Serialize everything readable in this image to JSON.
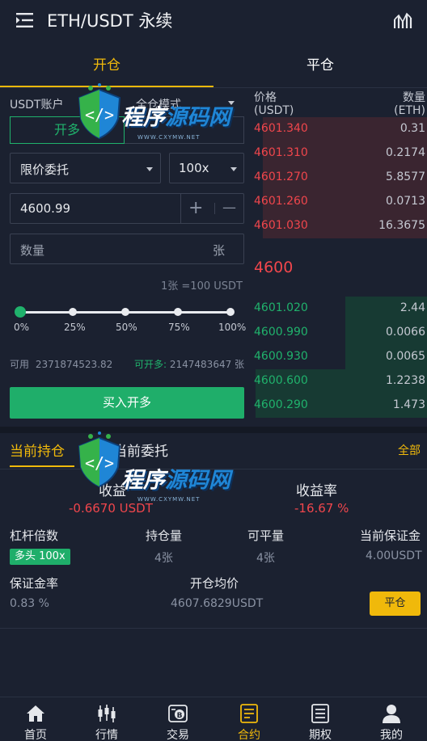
{
  "header": {
    "title": "ETH/USDT 永续"
  },
  "tabs": {
    "open": "开仓",
    "close": "平仓"
  },
  "form": {
    "account": "USDT账户",
    "margin_mode": "全仓模式",
    "side_long": "开多",
    "order_type": "限价委托",
    "leverage": "100x",
    "price": "4600.99",
    "plus": "+",
    "minus": "—",
    "qty_placeholder": "数量",
    "qty_unit": "张",
    "contract_note": "1张 =100 USDT",
    "slider": {
      "value_pct": 0,
      "labels": [
        "0%",
        "25%",
        "50%",
        "75%",
        "100%"
      ]
    },
    "available_label": "可用",
    "available_value": "2371874523.82",
    "can_open_label": "可开多:",
    "can_open_value": "2147483647 张",
    "buy_button": "买入开多"
  },
  "orderbook": {
    "price_header": "价格",
    "price_unit": "(USDT)",
    "qty_header": "数量",
    "qty_unit": "(ETH)",
    "asks": [
      {
        "price": "4601.340",
        "qty": "0.31",
        "depth": 0.95
      },
      {
        "price": "4601.310",
        "qty": "0.2174",
        "depth": 0.95
      },
      {
        "price": "4601.270",
        "qty": "5.8577",
        "depth": 0.95
      },
      {
        "price": "4601.260",
        "qty": "0.0713",
        "depth": 0.95
      },
      {
        "price": "4601.030",
        "qty": "16.3675",
        "depth": 0.95
      }
    ],
    "last_price": "4600",
    "bids": [
      {
        "price": "4601.020",
        "qty": "2.44",
        "depth": 0.47
      },
      {
        "price": "4600.990",
        "qty": "0.0066",
        "depth": 0.47
      },
      {
        "price": "4600.930",
        "qty": "0.0065",
        "depth": 0.47
      },
      {
        "price": "4600.600",
        "qty": "1.2238",
        "depth": 0.99
      },
      {
        "price": "4600.290",
        "qty": "1.473",
        "depth": 0.99
      }
    ]
  },
  "positions": {
    "tab_current": "当前持仓",
    "tab_orders": "当前委托",
    "all": "全部",
    "pnl_label": "收益",
    "pnl_value": "-0.6670 USDT",
    "roe_label": "收益率",
    "roe_value": "-16.67 %",
    "leverage_label": "杠杆倍数",
    "leverage_badge": "多头 100x",
    "size_label": "持仓量",
    "size_value": "4张",
    "closable_label": "可平量",
    "closable_value": "4张",
    "margin_label": "当前保证金",
    "margin_value": "4.00USDT",
    "margin_ratio_label": "保证金率",
    "margin_ratio_value": "0.83 %",
    "avg_price_label": "开仓均价",
    "avg_price_value": "4607.6829USDT",
    "close_button": "平仓"
  },
  "watermark": {
    "main_a": "程序",
    "main_b": "源码网",
    "sub": "WWW.CXYMW.NET"
  },
  "nav": [
    {
      "label": "首页",
      "icon": "home-icon"
    },
    {
      "label": "行情",
      "icon": "candlestick-icon"
    },
    {
      "label": "交易",
      "icon": "exchange-icon"
    },
    {
      "label": "合约",
      "icon": "contract-icon",
      "active": true
    },
    {
      "label": "期权",
      "icon": "options-icon"
    },
    {
      "label": "我的",
      "icon": "user-icon"
    }
  ],
  "colors": {
    "accent": "#f0b90b",
    "buy": "#20b26c",
    "sell": "#f0464c",
    "bg": "#1b2130"
  }
}
